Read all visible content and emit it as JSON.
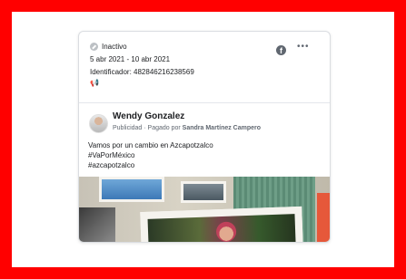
{
  "ad_meta": {
    "status": "Inactivo",
    "date_range": "5 abr 2021 - 10 abr 2021",
    "identifier": "Identificador: 482846216238569"
  },
  "post": {
    "page_name": "Wendy Gonzalez",
    "sponsored_prefix": "Publicidad · Pagado por ",
    "paid_by": "Sandra Martínez Campero",
    "text_line_1": "Vamos por un cambio en Azcapotzalco",
    "text_line_2": "#VaPorMéxico",
    "text_line_3": "#azcapotzalco"
  },
  "icons": {
    "status": "check-circle-icon",
    "platform": "facebook-icon",
    "more": "more-options-icon",
    "placement": "megaphone-icon"
  },
  "colors": {
    "frame_border": "#ff0000",
    "card_border": "#dadde1",
    "text_primary": "#1c1e21",
    "text_secondary": "#606770"
  }
}
